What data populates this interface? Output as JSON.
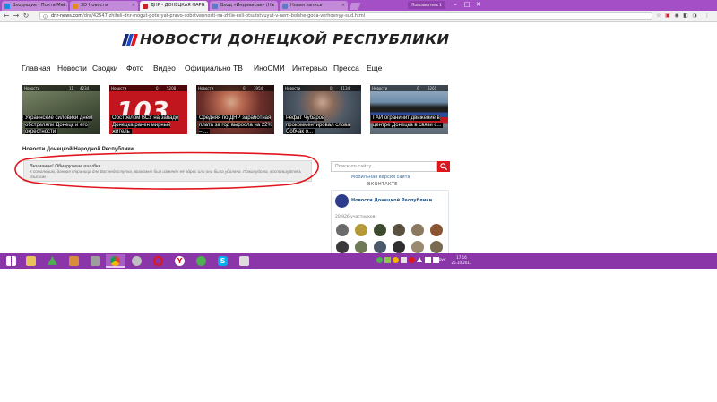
{
  "browser": {
    "tabs": [
      {
        "title": "Входящие - Почта Mail.",
        "favicon_color": "#168de2",
        "active": false
      },
      {
        "title": "3D Новости",
        "favicon_color": "#e48b1e",
        "active": false
      },
      {
        "title": "ДНР - ДОНЕЦКАЯ НАРО",
        "favicon_color": "#c9222b",
        "active": true
      },
      {
        "title": "Вход «Индивисав» (На",
        "favicon_color": "#5b7bc8",
        "active": false
      },
      {
        "title": "Новая запись",
        "favicon_color": "#5b7bc8",
        "active": false
      }
    ],
    "profile_label": "Пользователь 1",
    "url_host": "dnr-news.com",
    "url_path": "/dnr/42547-zhiteli-dnr-mogut-poteryat-pravo-sobstvennosti-na-zhile-esli-otsutstvuyut-v-nem-bolshe-goda-verhovnyy-sud.html"
  },
  "site": {
    "logo_text": "НОВОСТИ ДОНЕЦКОЙ РЕСПУБЛИКИ",
    "nav": [
      "Главная",
      "Новости",
      "Сводки",
      "Фото",
      "Видео",
      "Официально",
      "ТВ",
      "ИноСМИ",
      "Интервью",
      "Пресса",
      "Еще"
    ],
    "cards": [
      {
        "category": "Новости",
        "views": "4234",
        "comments": "11",
        "caption": "Украинские силовики днем обстреляли Донецк и его окрестности",
        "bg": "#5d6950"
      },
      {
        "category": "Новости",
        "views": "5208",
        "comments": "0",
        "caption": "Обстрелом ВСУ на западе Донецка ранен мирный житель",
        "bg": "#c2161f"
      },
      {
        "category": "Новости",
        "views": "3954",
        "comments": "0",
        "caption": "Средняя по ДНР заработная плата за год выросла на 22% – ...",
        "bg": "#8f4a3c"
      },
      {
        "category": "Новости",
        "views": "4134",
        "comments": "0",
        "caption": "Рефат Чубаров прокомментировал слова Собчак о...",
        "bg": "#4d5966"
      },
      {
        "category": "Новости",
        "views": "3261",
        "comments": "0",
        "caption": "ГАИ ограничит движение в центре Донецка в связи с...",
        "bg": "#6e8ca8"
      }
    ],
    "breadcrumb_title": "Новости Донецкой Народной Республики",
    "alert": {
      "heading": "Внимание! Обнаружена ошибка",
      "body": "К сожалению, данная страница для Вас недоступна, возможно был изменён её адрес или она была удалена. Пожалуйста, воспользуйтесь поиском."
    },
    "sidebar": {
      "search_placeholder": "Поиск по сайту...",
      "mobile_link": "Мобильная версия сайта",
      "vk_label": "ВКОНТАКТЕ",
      "group_name": "Новости Донецкой Республики",
      "members_count": "20 926 участников",
      "member_colors": [
        "#6b6b6b",
        "#b59a3a",
        "#3d4a30",
        "#5a5040",
        "#8b7a60",
        "#8a5530",
        "#3a3a3a",
        "#6d7a55",
        "#4a5a6a",
        "#2f2f2f",
        "#9a8a70",
        "#7a6a50"
      ]
    }
  },
  "taskbar": {
    "apps": [
      {
        "icon": "start-icon",
        "color": "#ffffff"
      },
      {
        "icon": "file-explorer-icon",
        "color": "#e8c35a"
      },
      {
        "icon": "drive-icon",
        "color": "#4caf50"
      },
      {
        "icon": "paint-icon",
        "color": "#d98c3a"
      },
      {
        "icon": "settings-icon",
        "color": "#9e9e9e"
      },
      {
        "icon": "chrome-icon",
        "color": "#f4b400"
      },
      {
        "icon": "network-icon",
        "color": "#c0c0c0"
      },
      {
        "icon": "opera-icon",
        "color": "#e0161c"
      },
      {
        "icon": "yandex-icon",
        "color": "#e0161c"
      },
      {
        "icon": "utorrent-icon",
        "color": "#4caf50"
      },
      {
        "icon": "skype-icon",
        "color": "#00aff0"
      },
      {
        "icon": "notepad-icon",
        "color": "#dcdcdc"
      }
    ],
    "language": "РУС",
    "time": "17:16",
    "date": "25.10.2017"
  }
}
